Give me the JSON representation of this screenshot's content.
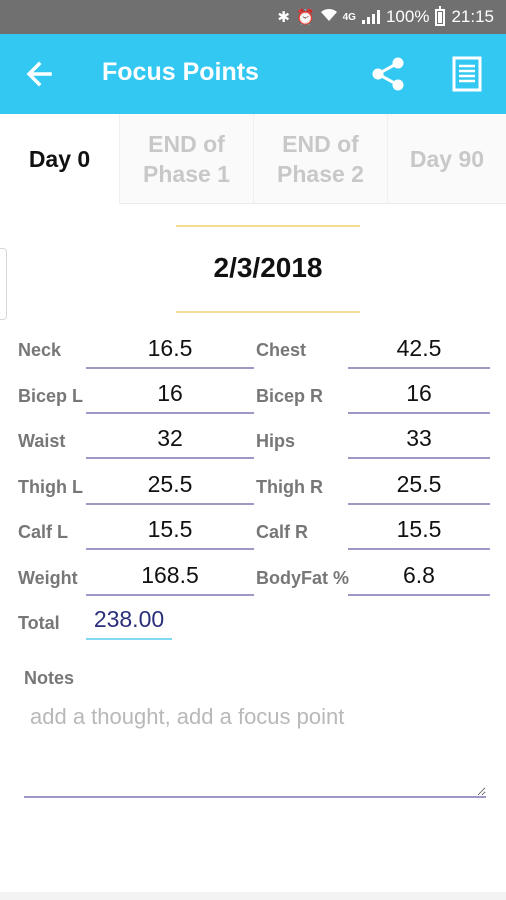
{
  "status_bar": {
    "battery": "100%",
    "time": "21:15",
    "network": "4G"
  },
  "app_bar": {
    "title": "Focus Points",
    "background_color": "#33c8f2"
  },
  "tabs": [
    {
      "line1": "Day 0",
      "line2": "",
      "active": true
    },
    {
      "line1": "END of",
      "line2": "Phase 1",
      "active": false
    },
    {
      "line1": "END of",
      "line2": "Phase 2",
      "active": false
    },
    {
      "line1": "Day 90",
      "line2": "",
      "active": false
    }
  ],
  "date": "2/3/2018",
  "measurements": [
    {
      "label": "Neck",
      "value": "16.5",
      "label2": "Chest",
      "value2": "42.5"
    },
    {
      "label": "Bicep L",
      "value": "16",
      "label2": "Bicep R",
      "value2": "16"
    },
    {
      "label": "Waist",
      "value": "32",
      "label2": "Hips",
      "value2": "33"
    },
    {
      "label": "Thigh L",
      "value": "25.5",
      "label2": "Thigh R",
      "value2": "25.5"
    },
    {
      "label": "Calf L",
      "value": "15.5",
      "label2": "Calf R",
      "value2": "15.5"
    },
    {
      "label": "Weight",
      "value": "168.5",
      "label2": "BodyFat %",
      "value2": "6.8"
    }
  ],
  "total": {
    "label": "Total",
    "value": "238.00"
  },
  "notes": {
    "label": "Notes",
    "placeholder": "add a thought, add a focus point"
  }
}
